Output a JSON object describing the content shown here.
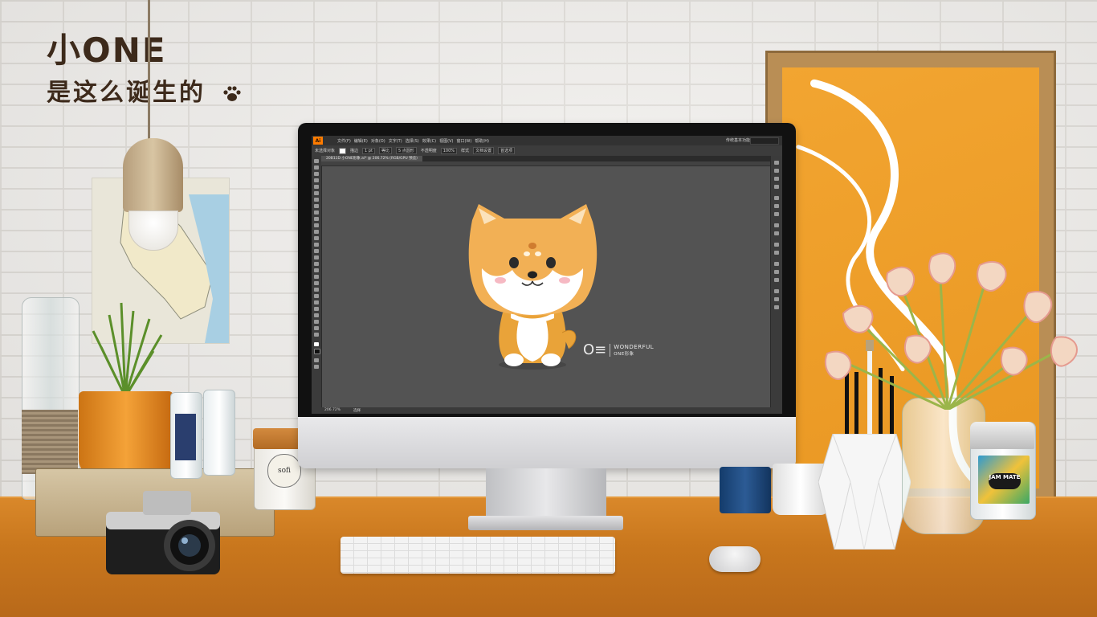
{
  "brand": {
    "title": "小ONE",
    "subtitle": "是这么诞生的"
  },
  "illustrator": {
    "app_logo": "Ai",
    "menu": [
      "文件(F)",
      "编辑(E)",
      "对象(O)",
      "文字(T)",
      "选择(S)",
      "效果(C)",
      "视图(V)",
      "窗口(W)",
      "帮助(H)"
    ],
    "workspace": "传统基本功能",
    "control_bar": [
      "未选择对象",
      "描边",
      "1 pt",
      "等比",
      "5 点圆形",
      "不透明度",
      "100%",
      "样式",
      "文档设置",
      "首选项"
    ],
    "document_tab": "20B11D 小ONE形象.ai* @ 206.72% (RGB/GPU 预览)",
    "status_zoom": "206.72%",
    "status_label": "选择",
    "watermark": {
      "mark": "O≡",
      "title": "WONDERFUL",
      "subtitle": "ONE形象"
    }
  },
  "desk": {
    "tin_label": "sofi",
    "jam_label": "JAM MATE"
  },
  "colors": {
    "accent_orange": "#f09a26",
    "ai_orange": "#ff7c00",
    "canvas_gray": "#535353",
    "brand_text": "#3d2a1b"
  },
  "icons": [
    "paw-icon",
    "lamp",
    "camera",
    "plant",
    "coffee-mug"
  ]
}
